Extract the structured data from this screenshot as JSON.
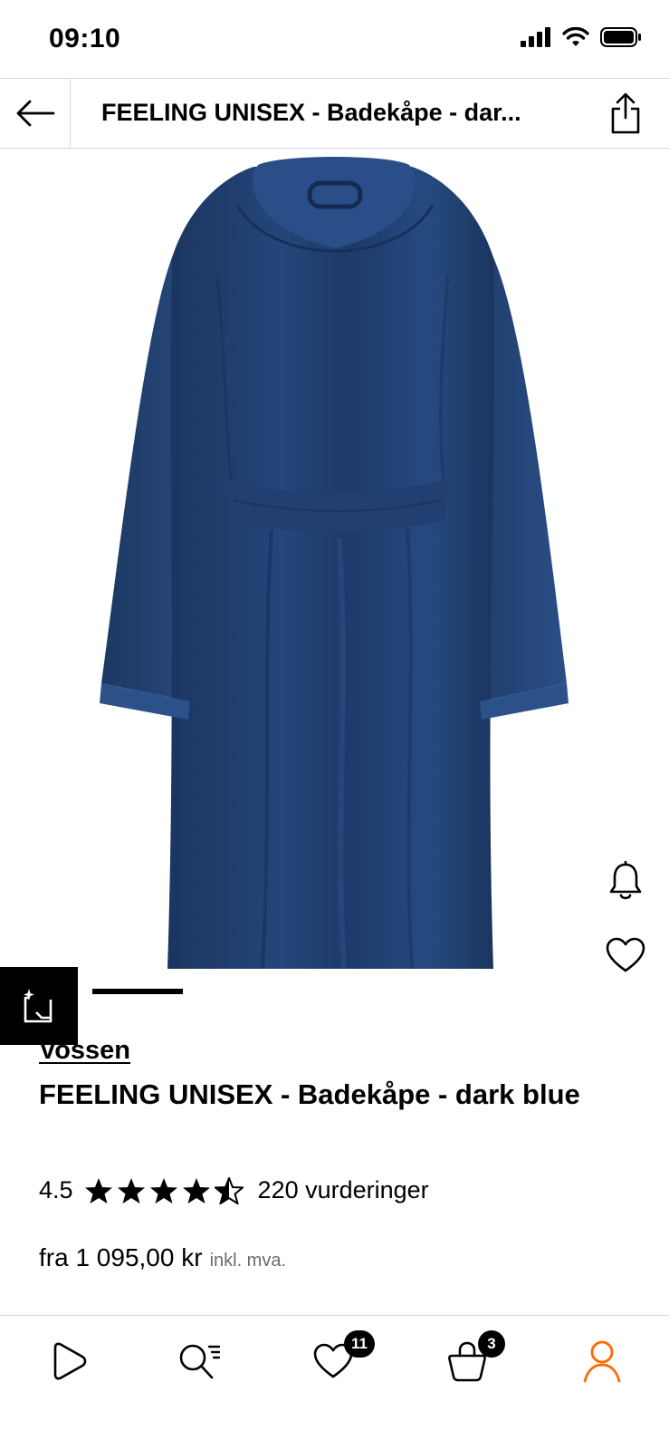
{
  "status_bar": {
    "time": "09:10"
  },
  "header": {
    "title": "FEELING UNISEX - Badekåpe - dar..."
  },
  "product": {
    "brand": "Vossen",
    "name": "FEELING UNISEX - Badekåpe - dark blue",
    "rating": "4.5",
    "rating_value": 4.5,
    "rating_max": 5,
    "reviews": "220 vurderinger",
    "price": "fra 1 095,00 kr",
    "vat_note": "inkl. mva.",
    "image_color": "#1f3d6b"
  },
  "bottom_nav": {
    "wishlist_badge": "11",
    "bag_badge": "3",
    "active_color": "#ff6900"
  },
  "icons": [
    "back-arrow-icon",
    "share-icon",
    "bell-icon",
    "heart-icon",
    "virtual-try-on-icon",
    "play-icon",
    "search-icon",
    "heart-icon",
    "bag-icon",
    "profile-icon"
  ]
}
